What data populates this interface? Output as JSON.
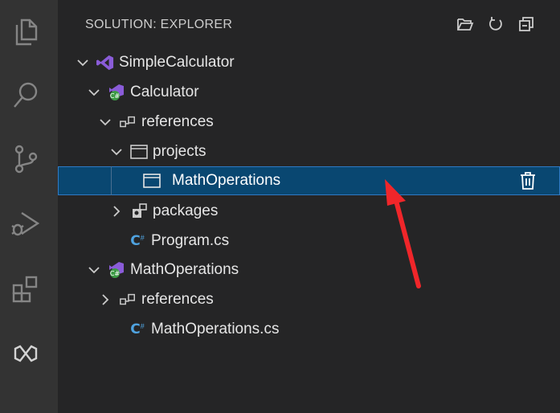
{
  "activity_bar": {
    "icons": [
      "explorer-icon",
      "search-icon",
      "source-control-icon",
      "run-debug-icon",
      "extensions-icon",
      "solution-explorer-icon"
    ]
  },
  "sidebar": {
    "title": "SOLUTION: EXPLORER",
    "actions": [
      "open-folder-icon",
      "refresh-icon",
      "collapse-all-icon"
    ],
    "tree": [
      {
        "label": "SimpleCalculator",
        "depth": 0,
        "expanded": true,
        "icon": "visual-studio-icon"
      },
      {
        "label": "Calculator",
        "depth": 1,
        "expanded": true,
        "icon": "csharp-project-icon"
      },
      {
        "label": "references",
        "depth": 2,
        "expanded": true,
        "icon": "references-icon"
      },
      {
        "label": "projects",
        "depth": 3,
        "expanded": true,
        "icon": "window-icon"
      },
      {
        "label": "MathOperations",
        "depth": 4,
        "selected": true,
        "icon": "window-icon"
      },
      {
        "label": "packages",
        "depth": 3,
        "expanded": false,
        "icon": "package-icon"
      },
      {
        "label": "Program.cs",
        "depth": 3,
        "icon": "csharp-file-icon"
      },
      {
        "label": "MathOperations",
        "depth": 1,
        "expanded": true,
        "icon": "csharp-project-icon"
      },
      {
        "label": "references",
        "depth": 2,
        "expanded": false,
        "icon": "references-icon"
      },
      {
        "label": "MathOperations.cs",
        "depth": 3,
        "icon": "csharp-file-icon"
      }
    ]
  },
  "colors": {
    "activity_bg": "#333333",
    "sidebar_bg": "#252526",
    "selection_bg": "#094771",
    "accent": "#2f7ac4",
    "vs_purple": "#8a5cd8",
    "csharp_blue": "#4fa3e0",
    "annotation_red": "#f0262a"
  }
}
